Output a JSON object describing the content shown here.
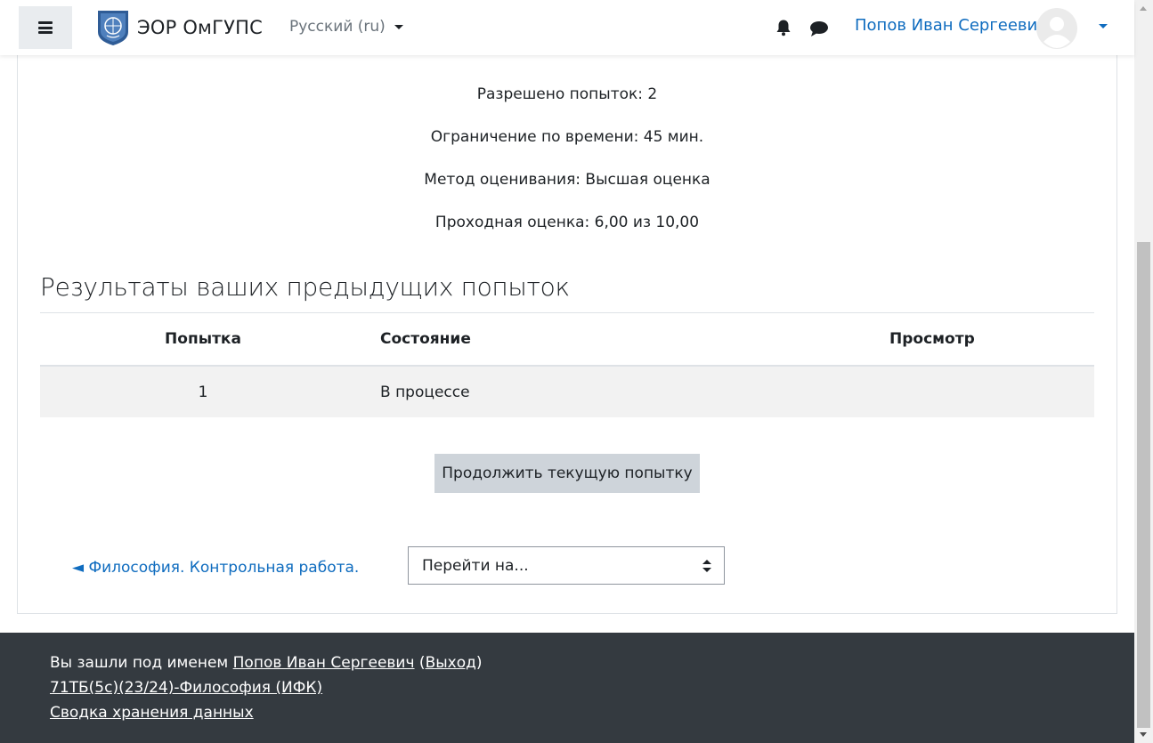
{
  "navbar": {
    "brand": "ЭОР ОмГУПС",
    "language": "Русский (ru)",
    "user_name": "Попов Иван Сергеевич",
    "icons": [
      "menu-icon",
      "bell-icon",
      "chat-icon",
      "avatar-icon",
      "chevron-down-icon"
    ]
  },
  "quiz_info": {
    "attempts_allowed": "Разрешено попыток: 2",
    "time_limit": "Ограничение по времени: 45 мин.",
    "grading_method": "Метод оценивания: Высшая оценка",
    "passing_grade": "Проходная оценка: 6,00 из 10,00"
  },
  "results": {
    "title": "Результаты ваших предыдущих попыток",
    "columns": [
      "Попытка",
      "Состояние",
      "Просмотр"
    ],
    "rows": [
      {
        "attempt": "1",
        "state": "В процессе",
        "review": ""
      }
    ]
  },
  "actions": {
    "continue_label": "Продолжить текущую попытку",
    "back_link": "◄ Философия. Контрольная работа.",
    "jump_placeholder": "Перейти на..."
  },
  "footer": {
    "logged_in_prefix": "Вы зашли под именем ",
    "user_link": "Попов Иван Сергеевич",
    "logout_open": " (",
    "logout_link": "Выход",
    "logout_close": ")",
    "course_link": "71ТБ(5с)(23/24)-Философия (ИФК)",
    "data_retention_link": "Сводка хранения данных"
  },
  "colors": {
    "accent": "#0f6cbf",
    "footer_bg": "#343a40",
    "button_bg": "#ced4da",
    "row_bg": "#f2f2f2"
  }
}
